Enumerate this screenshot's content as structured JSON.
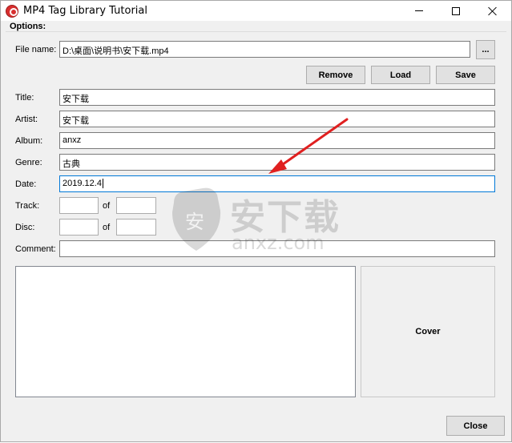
{
  "window": {
    "title": "MP4 Tag Library Tutorial",
    "icon": "app-icon",
    "controls": [
      "minimize-icon",
      "maximize-icon",
      "close-icon"
    ]
  },
  "options": {
    "group_label": "Options:",
    "file_name_label": "File name:",
    "file_name_value": "D:\\桌面\\说明书\\安下载.mp4",
    "browse_label": "...",
    "remove_label": "Remove",
    "load_label": "Load",
    "save_label": "Save",
    "title_label": "Title:",
    "title_value": "安下载",
    "artist_label": "Artist:",
    "artist_value": "安下载",
    "album_label": "Album:",
    "album_value": "anxz",
    "genre_label": "Genre:",
    "genre_value": "古典",
    "date_label": "Date:",
    "date_value": "2019.12.4",
    "track_label": "Track:",
    "track_value": "",
    "track_total_value": "",
    "disc_label": "Disc:",
    "disc_value": "",
    "disc_total_value": "",
    "of_label": "of",
    "comment_label": "Comment:",
    "comment_value": "",
    "cover_label": "Cover"
  },
  "footer": {
    "close_label": "Close"
  },
  "watermark": {
    "text": "安下载",
    "subtext": "anxz.com"
  },
  "colors": {
    "arrow": "#e02020",
    "focus_border": "#0078d7"
  }
}
